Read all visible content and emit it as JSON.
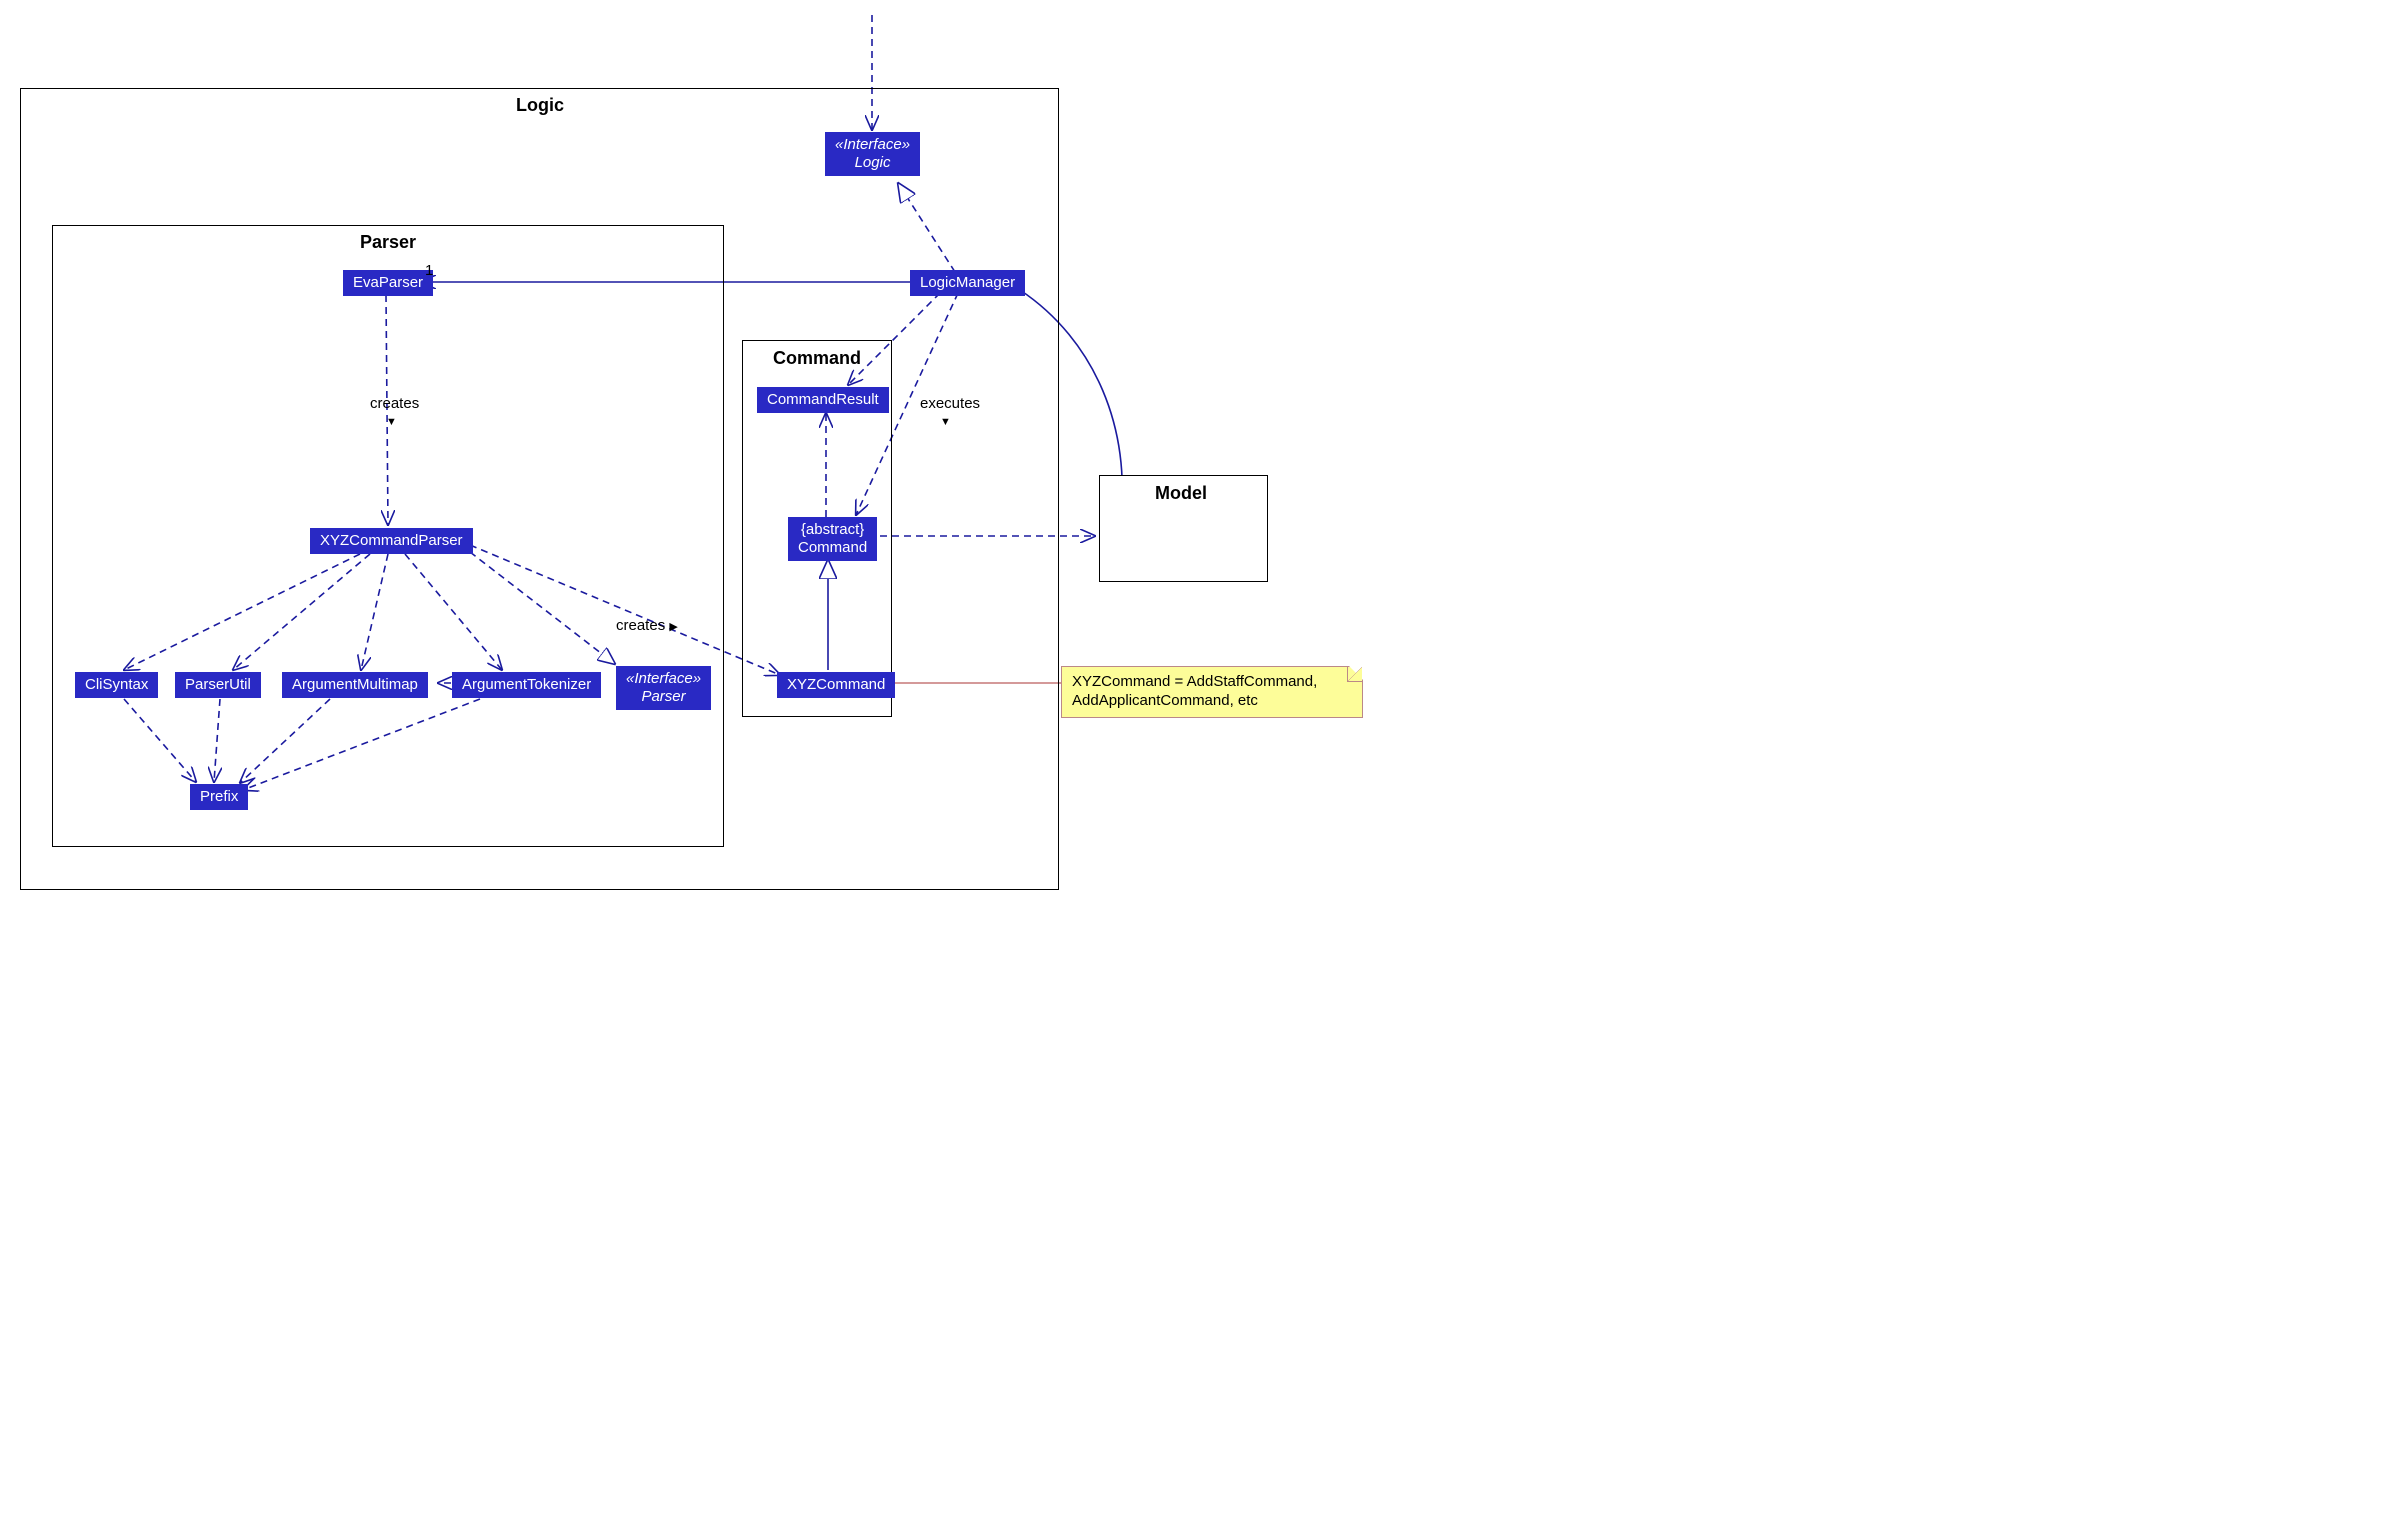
{
  "frames": {
    "logic": "Logic",
    "parser": "Parser",
    "command": "Command",
    "model": "Model"
  },
  "classes": {
    "interfaceLogic": {
      "stereotype": "«Interface»",
      "name": "Logic"
    },
    "logicManager": {
      "name": "LogicManager"
    },
    "evaParser": {
      "name": "EvaParser"
    },
    "xyzCommandParser": {
      "name": "XYZCommandParser"
    },
    "cliSyntax": {
      "name": "CliSyntax"
    },
    "parserUtil": {
      "name": "ParserUtil"
    },
    "argumentMultimap": {
      "name": "ArgumentMultimap"
    },
    "argumentTokenizer": {
      "name": "ArgumentTokenizer"
    },
    "interfaceParser": {
      "stereotype": "«Interface»",
      "name": "Parser"
    },
    "prefix": {
      "name": "Prefix"
    },
    "commandResult": {
      "name": "CommandResult"
    },
    "abstractCommand": {
      "stereotype": "{abstract}",
      "name": "Command"
    },
    "xyzCommand": {
      "name": "XYZCommand"
    }
  },
  "labels": {
    "creates1": {
      "text": "creates",
      "arrow": "▼"
    },
    "creates2": {
      "text": "creates",
      "arrow": "▶"
    },
    "executes": {
      "text": "executes",
      "arrow": "▼"
    }
  },
  "multiplicities": {
    "evaParser_one": "1"
  },
  "note": {
    "line1": "XYZCommand = AddStaffCommand,",
    "line2": "AddApplicantCommand, etc"
  },
  "colors": {
    "classFill": "#2929c4",
    "stroke": "#1a1a9e",
    "noteFill": "#fdfd99"
  }
}
